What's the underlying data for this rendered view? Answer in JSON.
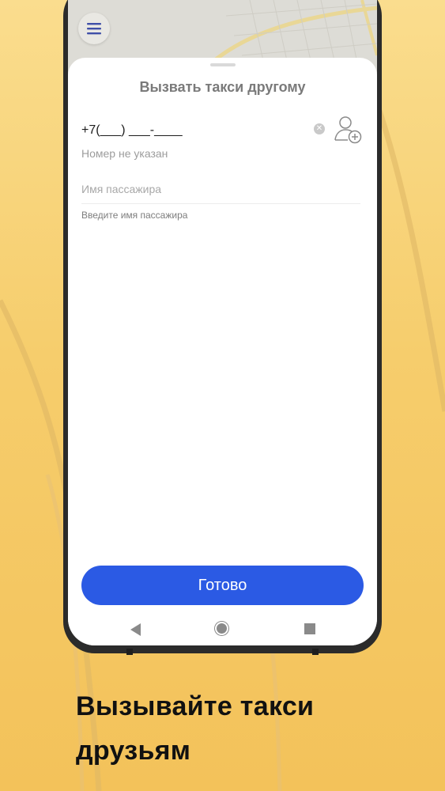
{
  "sheet": {
    "title": "Вызвать такси другому",
    "phone_value": "+7(___) ___-____",
    "phone_hint": "Номер не указан",
    "name_placeholder": "Имя пассажира",
    "name_value": "",
    "name_hint": "Введите имя пассажира",
    "done_label": "Готово"
  },
  "icons": {
    "menu": "hamburger-menu-icon",
    "clear": "clear-icon",
    "add_contact": "add-contact-icon",
    "nav_back": "nav-back-icon",
    "nav_home": "nav-home-icon",
    "nav_recent": "nav-recent-icon"
  },
  "promo": {
    "line1": "Вызывайте такси",
    "line2": "друзьям"
  },
  "colors": {
    "accent": "#2b5ae4",
    "background": "#f6cd6c",
    "menu_icon": "#3f4fa8"
  }
}
